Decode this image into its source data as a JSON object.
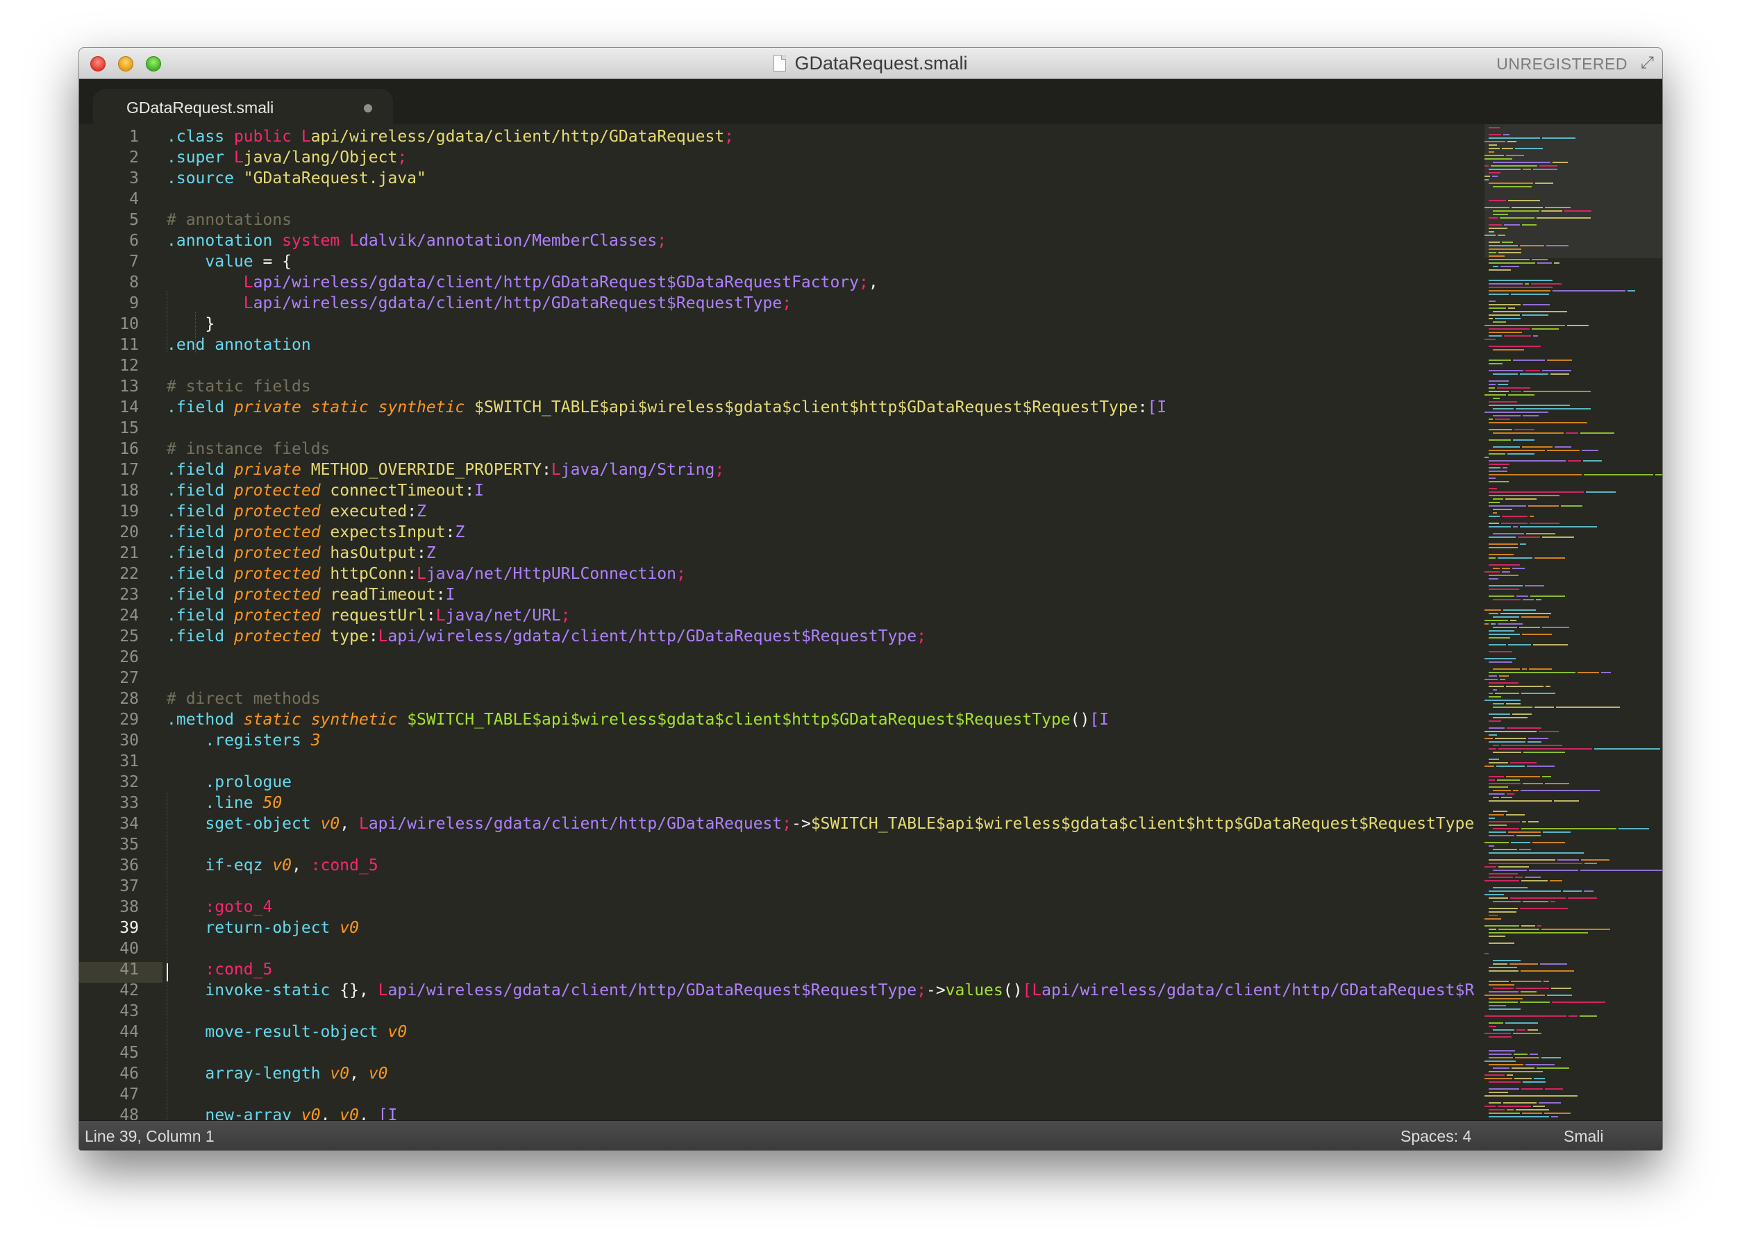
{
  "window": {
    "title": "GDataRequest.smali",
    "unregistered": "UNREGISTERED"
  },
  "tabs": [
    {
      "label": "GDataRequest.smali",
      "modified": true
    }
  ],
  "colors": {
    "background": "#272822",
    "foreground": "#f8f8f2",
    "comment": "#75715e",
    "keyword_pink": "#f92672",
    "directive_blue": "#66d9ef",
    "type_purple": "#ae81ff",
    "string_yellow": "#e6db74",
    "method_green": "#a6e22e",
    "register_orange": "#fd971f"
  },
  "editor": {
    "current_line": 39,
    "lines": [
      [
        {
          "t": ".class ",
          "c": "#66d9ef"
        },
        {
          "t": "public ",
          "c": "#f92672"
        },
        {
          "t": "L",
          "c": "#f92672"
        },
        {
          "t": "api/wireless/gdata/client/http/GDataRequest",
          "c": "#e6db74"
        },
        {
          "t": ";",
          "c": "#f92672"
        }
      ],
      [
        {
          "t": ".super ",
          "c": "#66d9ef"
        },
        {
          "t": "L",
          "c": "#f92672"
        },
        {
          "t": "java/lang/Object",
          "c": "#e6db74"
        },
        {
          "t": ";",
          "c": "#f92672"
        }
      ],
      [
        {
          "t": ".source ",
          "c": "#66d9ef"
        },
        {
          "t": "\"GDataRequest.java\"",
          "c": "#e6db74"
        }
      ],
      [],
      [
        {
          "t": "# annotations",
          "c": "#75715e"
        }
      ],
      [
        {
          "t": ".annotation ",
          "c": "#66d9ef"
        },
        {
          "t": "system ",
          "c": "#f92672"
        },
        {
          "t": "L",
          "c": "#f92672"
        },
        {
          "t": "dalvik/annotation/MemberClasses",
          "c": "#ae81ff"
        },
        {
          "t": ";",
          "c": "#f92672"
        }
      ],
      [
        {
          "t": "    value",
          "c": "#66d9ef"
        },
        {
          "t": " = {",
          "c": "#f8f8f2"
        }
      ],
      [
        {
          "t": "        L",
          "c": "#f92672"
        },
        {
          "t": "api/wireless/gdata/client/http/GDataRequest$GDataRequestFactory",
          "c": "#ae81ff"
        },
        {
          "t": ";",
          "c": "#f92672"
        },
        {
          "t": ",",
          "c": "#f8f8f2"
        }
      ],
      [
        {
          "t": "        L",
          "c": "#f92672"
        },
        {
          "t": "api/wireless/gdata/client/http/GDataRequest$RequestType",
          "c": "#ae81ff"
        },
        {
          "t": ";",
          "c": "#f92672"
        }
      ],
      [
        {
          "t": "    }",
          "c": "#f8f8f2"
        }
      ],
      [
        {
          "t": ".end annotation",
          "c": "#66d9ef"
        }
      ],
      [],
      [
        {
          "t": "# static fields",
          "c": "#75715e"
        }
      ],
      [
        {
          "t": ".field ",
          "c": "#66d9ef"
        },
        {
          "t": "private static synthetic ",
          "c": "#fd971f",
          "i": true
        },
        {
          "t": "$SWITCH_TABLE$api$wireless$gdata$client$http$GDataRequest$RequestType",
          "c": "#e6db74"
        },
        {
          "t": ":",
          "c": "#f8f8f2"
        },
        {
          "t": "[I",
          "c": "#ae81ff"
        }
      ],
      [],
      [
        {
          "t": "# instance fields",
          "c": "#75715e"
        }
      ],
      [
        {
          "t": ".field ",
          "c": "#66d9ef"
        },
        {
          "t": "private ",
          "c": "#fd971f",
          "i": true
        },
        {
          "t": "METHOD_OVERRIDE_PROPERTY",
          "c": "#e6db74"
        },
        {
          "t": ":",
          "c": "#f8f8f2"
        },
        {
          "t": "L",
          "c": "#f92672"
        },
        {
          "t": "java/lang/String",
          "c": "#ae81ff"
        },
        {
          "t": ";",
          "c": "#f92672"
        }
      ],
      [
        {
          "t": ".field ",
          "c": "#66d9ef"
        },
        {
          "t": "protected ",
          "c": "#fd971f",
          "i": true
        },
        {
          "t": "connectTimeout",
          "c": "#e6db74"
        },
        {
          "t": ":",
          "c": "#f8f8f2"
        },
        {
          "t": "I",
          "c": "#ae81ff"
        }
      ],
      [
        {
          "t": ".field ",
          "c": "#66d9ef"
        },
        {
          "t": "protected ",
          "c": "#fd971f",
          "i": true
        },
        {
          "t": "executed",
          "c": "#e6db74"
        },
        {
          "t": ":",
          "c": "#f8f8f2"
        },
        {
          "t": "Z",
          "c": "#ae81ff"
        }
      ],
      [
        {
          "t": ".field ",
          "c": "#66d9ef"
        },
        {
          "t": "protected ",
          "c": "#fd971f",
          "i": true
        },
        {
          "t": "expectsInput",
          "c": "#e6db74"
        },
        {
          "t": ":",
          "c": "#f8f8f2"
        },
        {
          "t": "Z",
          "c": "#ae81ff"
        }
      ],
      [
        {
          "t": ".field ",
          "c": "#66d9ef"
        },
        {
          "t": "protected ",
          "c": "#fd971f",
          "i": true
        },
        {
          "t": "hasOutput",
          "c": "#e6db74"
        },
        {
          "t": ":",
          "c": "#f8f8f2"
        },
        {
          "t": "Z",
          "c": "#ae81ff"
        }
      ],
      [
        {
          "t": ".field ",
          "c": "#66d9ef"
        },
        {
          "t": "protected ",
          "c": "#fd971f",
          "i": true
        },
        {
          "t": "httpConn",
          "c": "#e6db74"
        },
        {
          "t": ":",
          "c": "#f8f8f2"
        },
        {
          "t": "L",
          "c": "#f92672"
        },
        {
          "t": "java/net/HttpURLConnection",
          "c": "#ae81ff"
        },
        {
          "t": ";",
          "c": "#f92672"
        }
      ],
      [
        {
          "t": ".field ",
          "c": "#66d9ef"
        },
        {
          "t": "protected ",
          "c": "#fd971f",
          "i": true
        },
        {
          "t": "readTimeout",
          "c": "#e6db74"
        },
        {
          "t": ":",
          "c": "#f8f8f2"
        },
        {
          "t": "I",
          "c": "#ae81ff"
        }
      ],
      [
        {
          "t": ".field ",
          "c": "#66d9ef"
        },
        {
          "t": "protected ",
          "c": "#fd971f",
          "i": true
        },
        {
          "t": "requestUrl",
          "c": "#e6db74"
        },
        {
          "t": ":",
          "c": "#f8f8f2"
        },
        {
          "t": "L",
          "c": "#f92672"
        },
        {
          "t": "java/net/URL",
          "c": "#ae81ff"
        },
        {
          "t": ";",
          "c": "#f92672"
        }
      ],
      [
        {
          "t": ".field ",
          "c": "#66d9ef"
        },
        {
          "t": "protected ",
          "c": "#fd971f",
          "i": true
        },
        {
          "t": "type",
          "c": "#e6db74"
        },
        {
          "t": ":",
          "c": "#f8f8f2"
        },
        {
          "t": "L",
          "c": "#f92672"
        },
        {
          "t": "api/wireless/gdata/client/http/GDataRequest$RequestType",
          "c": "#ae81ff"
        },
        {
          "t": ";",
          "c": "#f92672"
        }
      ],
      [],
      [],
      [
        {
          "t": "# direct methods",
          "c": "#75715e"
        }
      ],
      [
        {
          "t": ".method ",
          "c": "#66d9ef"
        },
        {
          "t": "static synthetic ",
          "c": "#fd971f",
          "i": true
        },
        {
          "t": "$SWITCH_TABLE$api$wireless$gdata$client$http$GDataRequest$RequestType",
          "c": "#a6e22e"
        },
        {
          "t": "()",
          "c": "#f8f8f2"
        },
        {
          "t": "[I",
          "c": "#ae81ff"
        }
      ],
      [
        {
          "t": "    .registers ",
          "c": "#66d9ef"
        },
        {
          "t": "3",
          "c": "#fd971f",
          "i": true
        }
      ],
      [],
      [
        {
          "t": "    .prologue",
          "c": "#66d9ef"
        }
      ],
      [
        {
          "t": "    .line ",
          "c": "#66d9ef"
        },
        {
          "t": "50",
          "c": "#fd971f",
          "i": true
        }
      ],
      [
        {
          "t": "    sget-object ",
          "c": "#66d9ef"
        },
        {
          "t": "v0",
          "c": "#fd971f",
          "i": true
        },
        {
          "t": ", ",
          "c": "#f8f8f2"
        },
        {
          "t": "L",
          "c": "#f92672"
        },
        {
          "t": "api/wireless/gdata/client/http/GDataRequest",
          "c": "#ae81ff"
        },
        {
          "t": ";",
          "c": "#f92672"
        },
        {
          "t": "->",
          "c": "#f8f8f2"
        },
        {
          "t": "$SWITCH_TABLE$api$wireless$gdata$client$http$GDataRequest$RequestType",
          "c": "#e6db74"
        }
      ],
      [],
      [
        {
          "t": "    if-eqz ",
          "c": "#66d9ef"
        },
        {
          "t": "v0",
          "c": "#fd971f",
          "i": true
        },
        {
          "t": ", ",
          "c": "#f8f8f2"
        },
        {
          "t": ":cond_5",
          "c": "#f92672"
        }
      ],
      [],
      [
        {
          "t": "    :goto_4",
          "c": "#f92672"
        }
      ],
      [
        {
          "t": "    return-object ",
          "c": "#66d9ef"
        },
        {
          "t": "v0",
          "c": "#fd971f",
          "i": true
        }
      ],
      [],
      [
        {
          "t": "    :cond_5",
          "c": "#f92672"
        }
      ],
      [
        {
          "t": "    invoke-static ",
          "c": "#66d9ef"
        },
        {
          "t": "{}, ",
          "c": "#f8f8f2"
        },
        {
          "t": "L",
          "c": "#f92672"
        },
        {
          "t": "api/wireless/gdata/client/http/GDataRequest$RequestType",
          "c": "#ae81ff"
        },
        {
          "t": ";",
          "c": "#f92672"
        },
        {
          "t": "->",
          "c": "#f8f8f2"
        },
        {
          "t": "values",
          "c": "#a6e22e"
        },
        {
          "t": "()",
          "c": "#f8f8f2"
        },
        {
          "t": "[L",
          "c": "#f92672"
        },
        {
          "t": "api/wireless/gdata/client/http/GDataRequest$R",
          "c": "#ae81ff"
        }
      ],
      [],
      [
        {
          "t": "    move-result-object ",
          "c": "#66d9ef"
        },
        {
          "t": "v0",
          "c": "#fd971f",
          "i": true
        }
      ],
      [],
      [
        {
          "t": "    array-length ",
          "c": "#66d9ef"
        },
        {
          "t": "v0",
          "c": "#fd971f",
          "i": true
        },
        {
          "t": ", ",
          "c": "#f8f8f2"
        },
        {
          "t": "v0",
          "c": "#fd971f",
          "i": true
        }
      ],
      [],
      [
        {
          "t": "    new-array ",
          "c": "#66d9ef"
        },
        {
          "t": "v0",
          "c": "#fd971f",
          "i": true
        },
        {
          "t": ", ",
          "c": "#f8f8f2"
        },
        {
          "t": "v0",
          "c": "#fd971f",
          "i": true
        },
        {
          "t": ", ",
          "c": "#f8f8f2"
        },
        {
          "t": "[I",
          "c": "#ae81ff"
        }
      ]
    ]
  },
  "statusbar": {
    "position": "Line 39, Column 1",
    "indentation": "Spaces: 4",
    "syntax": "Smali"
  }
}
